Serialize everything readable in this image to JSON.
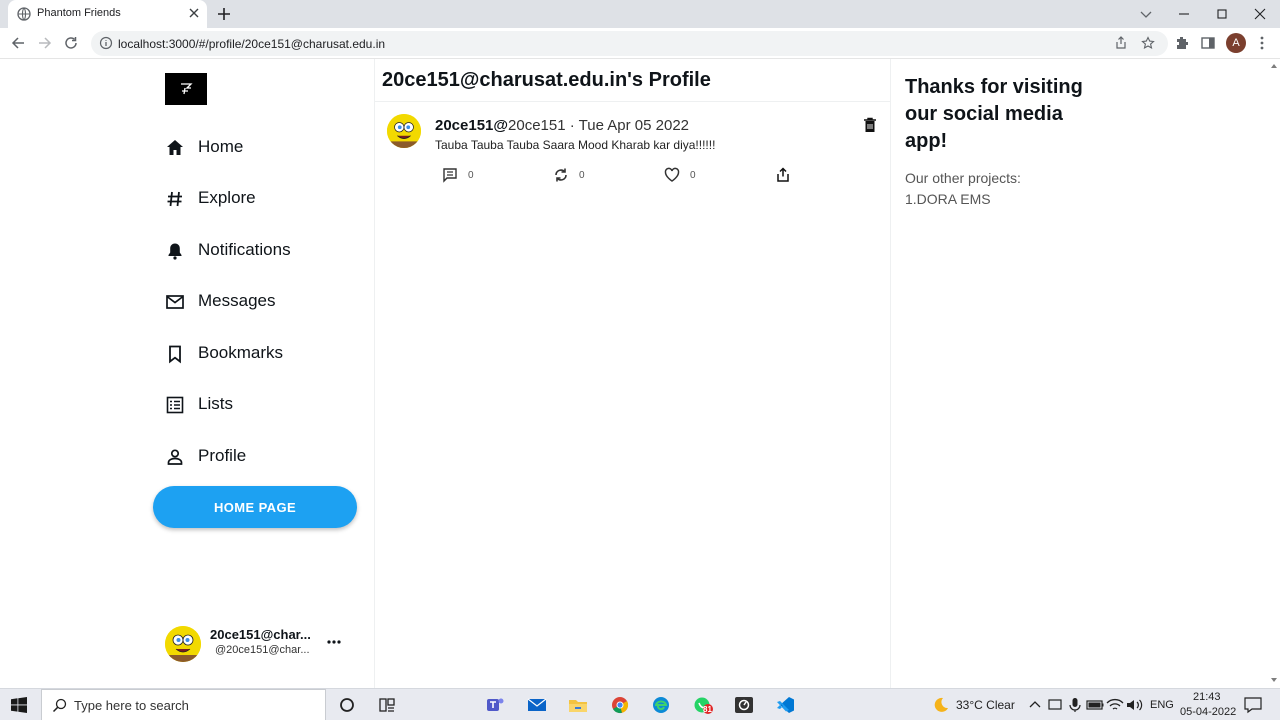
{
  "browser": {
    "tab_title": "Phantom Friends",
    "url": "localhost:3000/#/profile/20ce151@charusat.edu.in",
    "profile_initial": "A"
  },
  "sidebar": {
    "items": [
      {
        "label": "Home",
        "icon": "home-icon"
      },
      {
        "label": "Explore",
        "icon": "hashtag-icon"
      },
      {
        "label": "Notifications",
        "icon": "bell-icon"
      },
      {
        "label": "Messages",
        "icon": "mail-icon"
      },
      {
        "label": "Bookmarks",
        "icon": "bookmark-icon"
      },
      {
        "label": "Lists",
        "icon": "list-icon"
      },
      {
        "label": "Profile",
        "icon": "person-icon"
      }
    ],
    "home_button": "HOME PAGE",
    "user": {
      "name": "20ce151@char...",
      "handle": "@20ce151@char..."
    }
  },
  "main": {
    "title": "20ce151@charusat.edu.in's Profile",
    "post": {
      "username": "20ce151@",
      "handle_and_date": "20ce151 · Tue Apr 05 2022",
      "text": "Tauba Tauba Tauba Saara Mood Kharab kar diya!!!!!!",
      "comments": "0",
      "retweets": "0",
      "likes": "0"
    }
  },
  "right": {
    "title": "Thanks for visiting our social media app!",
    "subtitle": "Our other projects:",
    "project": "1.DORA EMS"
  },
  "taskbar": {
    "search_placeholder": "Type here to search",
    "weather": "33°C  Clear",
    "language": "ENG",
    "time": "21:43",
    "date": "05-04-2022",
    "whatsapp_badge": "81"
  },
  "colors": {
    "accent": "#1da1f2",
    "chrome_tab_bg": "#dee1e6",
    "taskbar_bg": "#e8eaf0"
  }
}
